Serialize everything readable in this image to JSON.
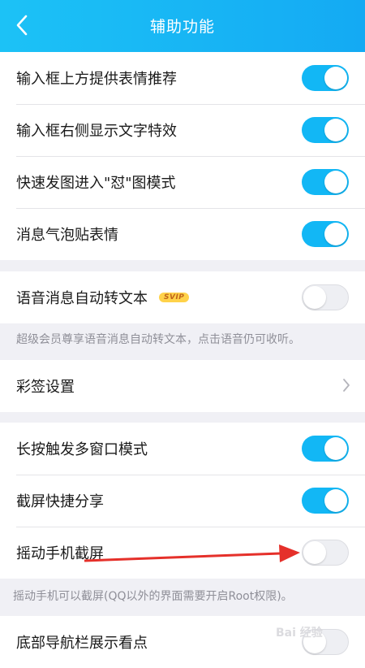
{
  "header": {
    "title": "辅助功能"
  },
  "group1": [
    {
      "label": "输入框上方提供表情推荐",
      "on": true
    },
    {
      "label": "输入框右侧显示文字特效",
      "on": true
    },
    {
      "label": "快速发图进入\"怼\"图模式",
      "on": true
    },
    {
      "label": "消息气泡贴表情",
      "on": true
    }
  ],
  "voice": {
    "label": "语音消息自动转文本",
    "badge": "SVIP",
    "on": false
  },
  "voice_note": "超级会员尊享语音消息自动转文本，点击语音仍可收听。",
  "caiqian": {
    "label": "彩签设置"
  },
  "group3": [
    {
      "label": "长按触发多窗口模式",
      "on": true
    },
    {
      "label": "截屏快捷分享",
      "on": true
    },
    {
      "label": "摇动手机截屏",
      "on": false
    }
  ],
  "shake_note": "摇动手机可以截屏(QQ以外的界面需要开启Root权限)。",
  "bottom": {
    "label": "底部导航栏展示看点",
    "on": false
  },
  "watermark": "Bai 经验",
  "colors": {
    "accent": "#12b7f5",
    "annotation_arrow": "#e5302a"
  }
}
